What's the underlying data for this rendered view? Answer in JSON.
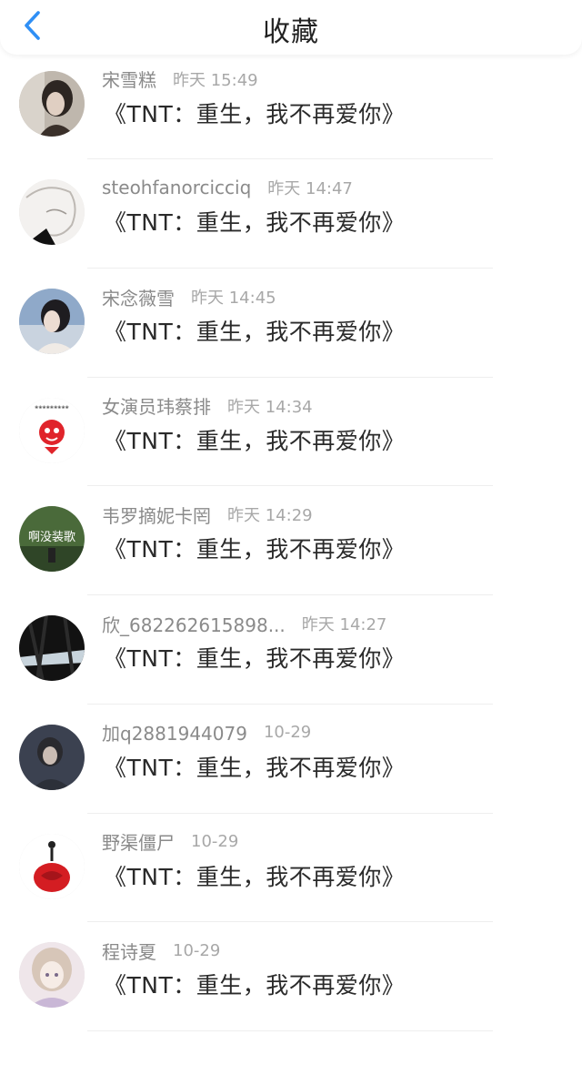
{
  "header": {
    "title": "收藏",
    "back_icon": "chevron-left-icon",
    "accent_color": "#2f8ff5"
  },
  "items": [
    {
      "name": "",
      "time": "",
      "content": "《TNT：重生，我不再爱你》",
      "avatar": "red-dark-avatar"
    },
    {
      "name": "宋雪糕",
      "time": "昨天 15:49",
      "content": "《TNT：重生，我不再爱你》",
      "avatar": "girl-portrait-avatar"
    },
    {
      "name": "steohfanorcicciq",
      "time": "昨天 14:47",
      "content": "《TNT：重生，我不再爱你》",
      "avatar": "sketch-face-avatar"
    },
    {
      "name": "宋念薇雪",
      "time": "昨天 14:45",
      "content": "《TNT：重生，我不再爱你》",
      "avatar": "girl-blue-sky-avatar"
    },
    {
      "name": "女演员玮蔡排",
      "time": "昨天 14:34",
      "content": "《TNT：重生，我不再爱你》",
      "avatar": "red-cartoon-avatar"
    },
    {
      "name": "韦罗摘妮卡罔",
      "time": "昨天 14:29",
      "content": "《TNT：重生，我不再爱你》",
      "avatar": "green-text-avatar",
      "avatar_text": "啊没装歌"
    },
    {
      "name": "欣_682262615898...",
      "time": "昨天 14:27",
      "content": "《TNT：重生，我不再爱你》",
      "avatar": "dark-landscape-avatar"
    },
    {
      "name": "加q2881944079",
      "time": "10-29",
      "content": "《TNT：重生，我不再爱你》",
      "avatar": "girl-dark-avatar"
    },
    {
      "name": "野渠僵尸",
      "time": "10-29",
      "content": "《TNT：重生，我不再爱你》",
      "avatar": "red-rose-avatar"
    },
    {
      "name": "程诗夏",
      "time": "10-29",
      "content": "《TNT：重生，我不再爱你》",
      "avatar": "anime-girl-avatar"
    }
  ]
}
